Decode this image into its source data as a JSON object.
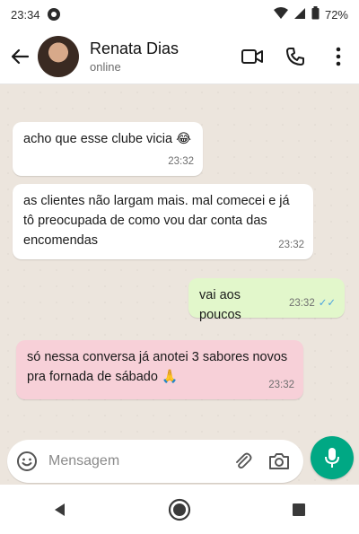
{
  "status": {
    "time": "23:34",
    "battery": "72%"
  },
  "header": {
    "name": "Renata Dias",
    "status": "online"
  },
  "messages": [
    {
      "text": "acho que esse clube vicia 😂",
      "time": "23:32"
    },
    {
      "text": "as clientes não largam mais. mal comecei e já tô preocupada de como vou dar conta das encomendas",
      "time": "23:32"
    },
    {
      "text": "vai aos poucos",
      "time": "23:32"
    },
    {
      "text": "só nessa conversa já anotei 3 sabores novos pra fornada de sábado 🙏",
      "time": "23:32"
    }
  ],
  "composer": {
    "placeholder": "Mensagem"
  },
  "colors": {
    "accent": "#00a884",
    "outgoing": "#e2f7cb",
    "highlight": "#f7d0d8",
    "chat_bg": "#ece5dd"
  }
}
